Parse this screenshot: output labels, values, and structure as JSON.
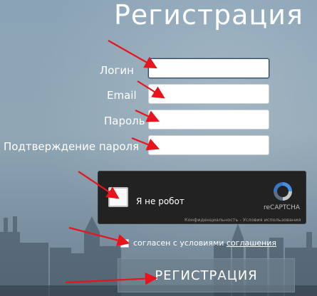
{
  "page": {
    "title": "Регистрация"
  },
  "form": {
    "login_label": "Логин",
    "email_label": "Email",
    "password_label": "Пароль",
    "confirm_label": "Подтверждение пароля",
    "login_value": "",
    "email_value": "",
    "password_value": "",
    "confirm_value": ""
  },
  "recaptcha": {
    "label": "Я не робот",
    "brand": "reCAPTCHA",
    "privacy": "Конфиденциальность",
    "separator": " - ",
    "terms": "Условия использования"
  },
  "agree": {
    "text": "согласен с условиями ",
    "link": "соглашения"
  },
  "submit": {
    "label": "РЕГИСТРАЦИЯ"
  },
  "colors": {
    "annotation_arrow": "#e8141b",
    "recaptcha_bg": "#222222"
  },
  "icons": {
    "recaptcha_logo": "recaptcha-logo-icon",
    "arrow": "red-arrow-icon"
  }
}
